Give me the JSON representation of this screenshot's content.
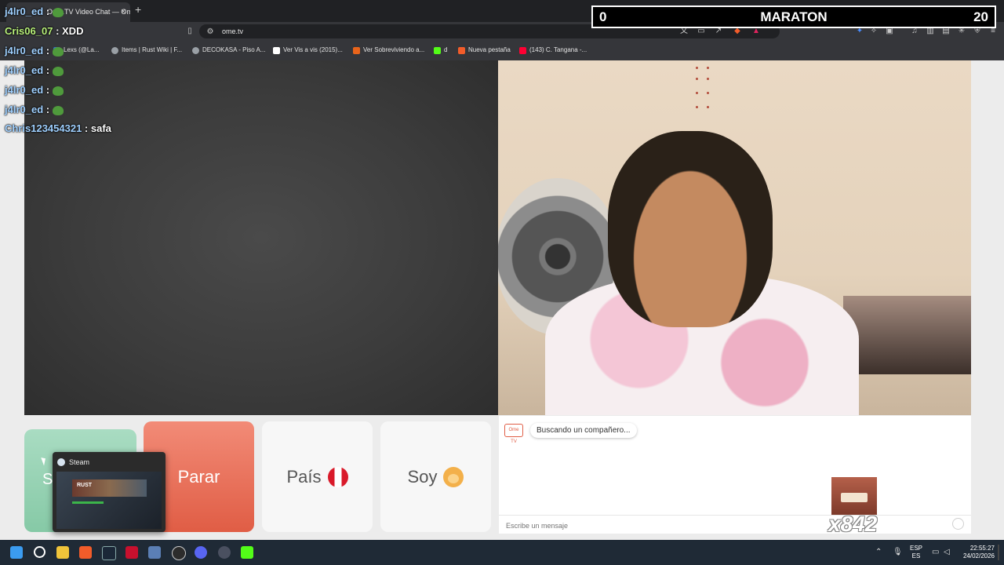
{
  "browser": {
    "tab_title": "Ome.TV Video Chat — Omegle",
    "new_tab": "+",
    "tab_close": "×",
    "url": "ome.tv",
    "bookmarks": [
      {
        "label": "Lexs (@La...",
        "color": "#2f6fd6"
      },
      {
        "label": "Items | Rust Wiki | F...",
        "color": "#9aa0a6"
      },
      {
        "label": "DECOKASA - Piso A...",
        "color": "#9aa0a6"
      },
      {
        "label": "Ver Vis a vis (2015)...",
        "color": "#ffffff"
      },
      {
        "label": "Ver Sobreviviendo a...",
        "color": "#e8641b"
      },
      {
        "label": "d",
        "color": "#53fc18"
      },
      {
        "label": "Nueva pestaña",
        "color": "#f25c2a"
      },
      {
        "label": "(143) C. Tangana -...",
        "color": "#ff0033"
      }
    ]
  },
  "stream_overlay": {
    "scoreboard": {
      "left": "0",
      "title": "MARATON",
      "right": "20"
    },
    "chat": [
      {
        "user": "j4lr0_ed",
        "sep": " : ",
        "msg": "",
        "emote": true
      },
      {
        "user": "Cris06_07",
        "sep": " : ",
        "msg": "XDD",
        "emote": false
      },
      {
        "user": "j4lr0_ed",
        "sep": " : ",
        "msg": "",
        "emote": true
      },
      {
        "user": "j4lr0_ed",
        "sep": " : ",
        "msg": "",
        "emote": true
      },
      {
        "user": "j4lr0_ed",
        "sep": " : ",
        "msg": "",
        "emote": true
      },
      {
        "user": "j4lr0_ed",
        "sep": " : ",
        "msg": "",
        "emote": true
      },
      {
        "user": "Chris123454321",
        "sep": " : ",
        "msg": "safa",
        "emote": false
      }
    ],
    "combo_count": "x842"
  },
  "ometv": {
    "buttons": {
      "start": "S",
      "stop": "Parar",
      "country": "País",
      "gender": "Soy"
    },
    "logo_text": "Ome TV",
    "status_message": "Buscando un compañero...",
    "message_placeholder": "Escribe un mensaje"
  },
  "taskbar_popup": {
    "title": "Steam",
    "preview_label": "RUST"
  },
  "taskbar": {
    "lang_top": "ESP",
    "lang_bottom": "ES",
    "time": "22:55:27",
    "date": "24/02/2026"
  }
}
